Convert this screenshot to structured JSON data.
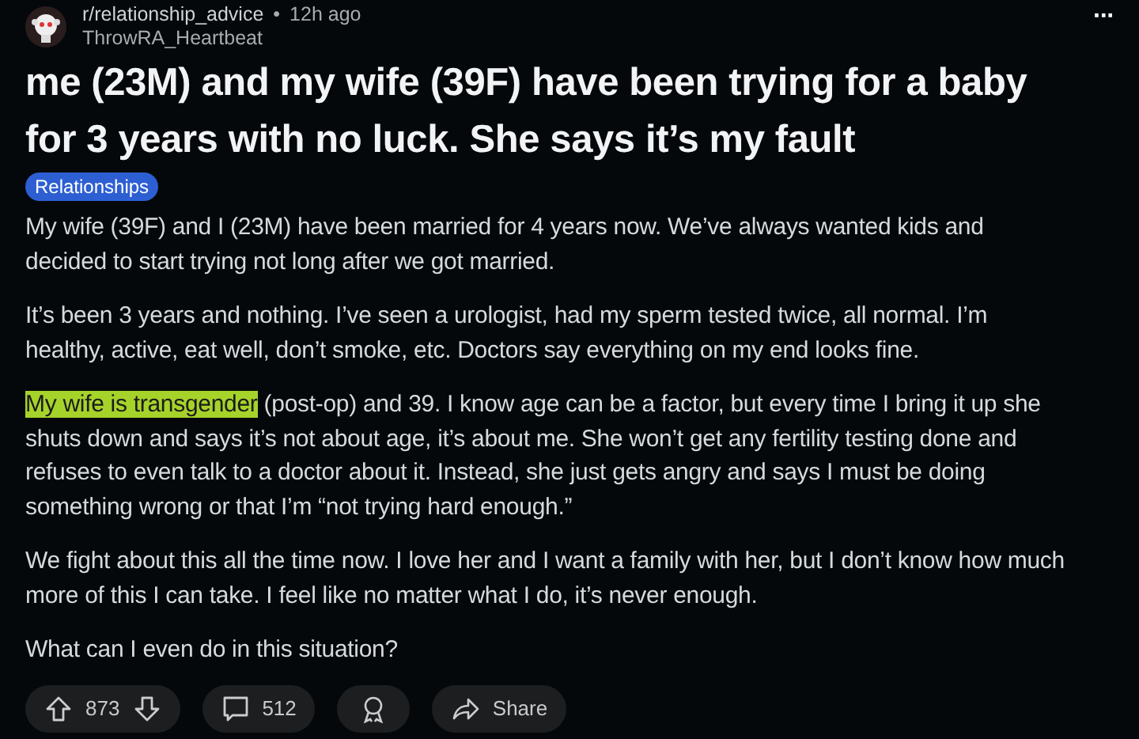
{
  "post": {
    "subreddit": "r/relationship_advice",
    "separator": "•",
    "time": "12h ago",
    "author": "ThrowRA_Heartbeat",
    "more": "···",
    "title": "me (23M) and my wife (39F) have been trying for a baby for 3 years with no luck. She says it’s my fault",
    "flair": "Relationships",
    "paragraphs": [
      [
        {
          "text": "My wife (39F) and I (23M) have been married for 4 years now. We’ve always wanted kids and decided to start trying not long after we got married.",
          "highlighted": false
        }
      ],
      [
        {
          "text": "It’s been 3 years and nothing. I’ve seen a urologist, had my sperm tested twice, all normal. I’m healthy, active, eat well, don’t smoke, etc. Doctors say everything on my end looks fine.",
          "highlighted": false
        }
      ],
      [
        {
          "text": "My wife is transgender",
          "highlighted": true
        },
        {
          "text": " (post-op) and 39. I know age can be a factor, but every time I bring it up she shuts down and says it’s not about age, it’s about me. She won’t get any fertility testing done and refuses to even talk to a doctor about it. Instead, she just gets angry and says I must be doing something wrong or that I’m “not trying hard enough.”",
          "highlighted": false
        }
      ],
      [
        {
          "text": "We fight about this all the time now. I love her and I want a family with her, but I don’t know how much more of this I can take. I feel like no matter what I do, it’s never enough.",
          "highlighted": false
        }
      ],
      [
        {
          "text": "What can I even do in this situation?",
          "highlighted": false
        }
      ]
    ],
    "actions": [
      {
        "kind": "vote",
        "count": "873"
      },
      {
        "kind": "comments",
        "count": "512"
      },
      {
        "kind": "award"
      },
      {
        "kind": "share",
        "label": "Share"
      }
    ]
  }
}
